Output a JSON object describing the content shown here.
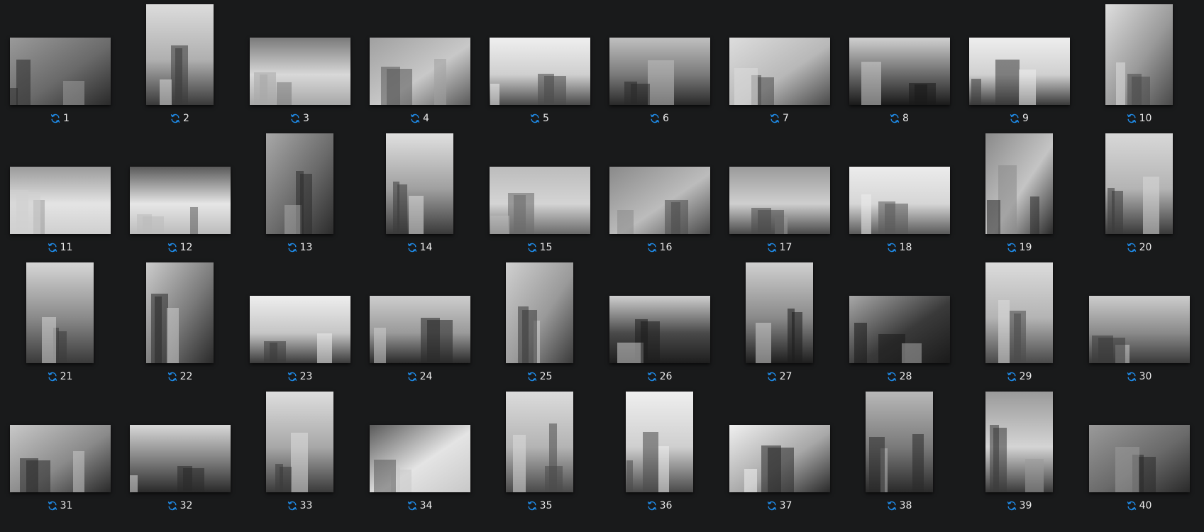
{
  "accent_color": "#1f8ae6",
  "status_icon": "sync-icon",
  "photos": [
    {
      "label": "1",
      "orientation": "landscape",
      "tones": [
        "#6a6a6a",
        "#2a2a2a",
        "#9a9a9a"
      ]
    },
    {
      "label": "2",
      "orientation": "portrait",
      "tones": [
        "#b0b0b0",
        "#3a3a3a",
        "#dcdcdc"
      ]
    },
    {
      "label": "3",
      "orientation": "landscape",
      "tones": [
        "#d8d8d8",
        "#a8a8a8",
        "#7a7a7a"
      ]
    },
    {
      "label": "4",
      "orientation": "landscape",
      "tones": [
        "#c8c8c8",
        "#5a5a5a",
        "#a0a0a0"
      ]
    },
    {
      "label": "5",
      "orientation": "landscape",
      "tones": [
        "#cfcfcf",
        "#4a4a4a",
        "#efefef"
      ]
    },
    {
      "label": "6",
      "orientation": "landscape",
      "tones": [
        "#7a7a7a",
        "#2a2a2a",
        "#c0c0c0"
      ]
    },
    {
      "label": "7",
      "orientation": "landscape",
      "tones": [
        "#b8b8b8",
        "#4a4a4a",
        "#dddddd"
      ]
    },
    {
      "label": "8",
      "orientation": "landscape",
      "tones": [
        "#6a6a6a",
        "#1a1a1a",
        "#d0d0d0"
      ]
    },
    {
      "label": "9",
      "orientation": "landscape",
      "tones": [
        "#d0d0d0",
        "#3a3a3a",
        "#eeeeee"
      ]
    },
    {
      "label": "10",
      "orientation": "portrait",
      "tones": [
        "#9a9a9a",
        "#4a4a4a",
        "#dedede"
      ]
    },
    {
      "label": "11",
      "orientation": "landscape",
      "tones": [
        "#e4e4e4",
        "#cfcfcf",
        "#9a9a9a"
      ]
    },
    {
      "label": "12",
      "orientation": "landscape",
      "tones": [
        "#e6e6e6",
        "#bcbcbc",
        "#5a5a5a"
      ]
    },
    {
      "label": "13",
      "orientation": "portrait",
      "tones": [
        "#6a6a6a",
        "#2c2c2c",
        "#a8a8a8"
      ]
    },
    {
      "label": "14",
      "orientation": "portrait",
      "tones": [
        "#a0a0a0",
        "#3a3a3a",
        "#e0e0e0"
      ]
    },
    {
      "label": "15",
      "orientation": "landscape",
      "tones": [
        "#d4d4d4",
        "#6a6a6a",
        "#bcbcbc"
      ]
    },
    {
      "label": "16",
      "orientation": "landscape",
      "tones": [
        "#bcbcbc",
        "#4a4a4a",
        "#8a8a8a"
      ]
    },
    {
      "label": "17",
      "orientation": "landscape",
      "tones": [
        "#cfcfcf",
        "#4a4a4a",
        "#9a9a9a"
      ]
    },
    {
      "label": "18",
      "orientation": "landscape",
      "tones": [
        "#d6d6d6",
        "#5a5a5a",
        "#ececec"
      ]
    },
    {
      "label": "19",
      "orientation": "portrait",
      "tones": [
        "#c4c4c4",
        "#2a2a2a",
        "#8a8a8a"
      ]
    },
    {
      "label": "20",
      "orientation": "portrait",
      "tones": [
        "#b4b4b4",
        "#3a3a3a",
        "#d8d8d8"
      ]
    },
    {
      "label": "21",
      "orientation": "portrait",
      "tones": [
        "#8a8a8a",
        "#3a3a3a",
        "#d6d6d6"
      ]
    },
    {
      "label": "22",
      "orientation": "portrait",
      "tones": [
        "#7a7a7a",
        "#2a2a2a",
        "#cccccc"
      ]
    },
    {
      "label": "23",
      "orientation": "landscape",
      "tones": [
        "#c6c6c6",
        "#3a3a3a",
        "#eeeeee"
      ]
    },
    {
      "label": "24",
      "orientation": "landscape",
      "tones": [
        "#9a9a9a",
        "#2a2a2a",
        "#cdcdcd"
      ]
    },
    {
      "label": "25",
      "orientation": "portrait",
      "tones": [
        "#9a9a9a",
        "#3a3a3a",
        "#d0d0d0"
      ]
    },
    {
      "label": "26",
      "orientation": "landscape",
      "tones": [
        "#4a4a4a",
        "#1e1e1e",
        "#cfcfcf"
      ]
    },
    {
      "label": "27",
      "orientation": "portrait",
      "tones": [
        "#8a8a8a",
        "#1e1e1e",
        "#d0d0d0"
      ]
    },
    {
      "label": "28",
      "orientation": "landscape",
      "tones": [
        "#3a3a3a",
        "#1a1a1a",
        "#a8a8a8"
      ]
    },
    {
      "label": "29",
      "orientation": "portrait",
      "tones": [
        "#b4b4b4",
        "#4a4a4a",
        "#dcdcdc"
      ]
    },
    {
      "label": "30",
      "orientation": "landscape",
      "tones": [
        "#8a8a8a",
        "#3a3a3a",
        "#cdcdcd"
      ]
    },
    {
      "label": "31",
      "orientation": "landscape",
      "tones": [
        "#8a8a8a",
        "#2a2a2a",
        "#c8c8c8"
      ]
    },
    {
      "label": "32",
      "orientation": "landscape",
      "tones": [
        "#7a7a7a",
        "#2a2a2a",
        "#d8d8d8"
      ]
    },
    {
      "label": "33",
      "orientation": "portrait",
      "tones": [
        "#a8a8a8",
        "#3a3a3a",
        "#dedede"
      ]
    },
    {
      "label": "34",
      "orientation": "landscape",
      "tones": [
        "#e4e4e4",
        "#c8c8c8",
        "#5a5a5a"
      ]
    },
    {
      "label": "35",
      "orientation": "portrait",
      "tones": [
        "#b4b4b4",
        "#4a4a4a",
        "#dcdcdc"
      ]
    },
    {
      "label": "36",
      "orientation": "portrait",
      "tones": [
        "#cfcfcf",
        "#4a4a4a",
        "#efefef"
      ]
    },
    {
      "label": "37",
      "orientation": "landscape",
      "tones": [
        "#a8a8a8",
        "#2a2a2a",
        "#f0f0f0"
      ]
    },
    {
      "label": "38",
      "orientation": "portrait",
      "tones": [
        "#7a7a7a",
        "#2a2a2a",
        "#b8b8b8"
      ]
    },
    {
      "label": "39",
      "orientation": "portrait",
      "tones": [
        "#d4d4d4",
        "#3a3a3a",
        "#9a9a9a"
      ]
    },
    {
      "label": "40",
      "orientation": "landscape",
      "tones": [
        "#6a6a6a",
        "#2a2a2a",
        "#9a9a9a"
      ]
    }
  ]
}
